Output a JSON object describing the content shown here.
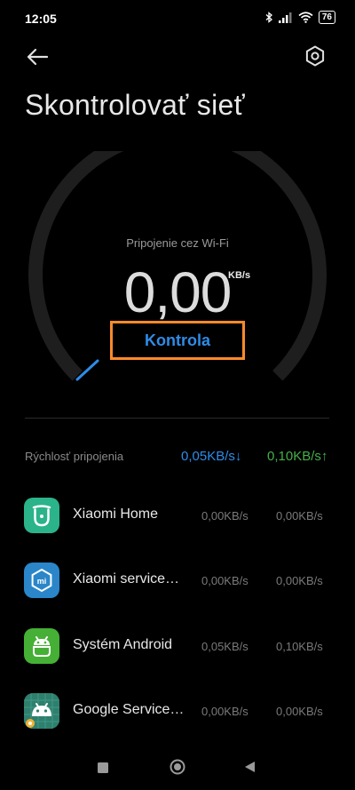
{
  "status": {
    "time": "12:05",
    "battery": "76"
  },
  "page": {
    "title": "Skontrolovať sieť"
  },
  "gauge": {
    "connection_label": "Pripojenie cez Wi-Fi",
    "speed_value": "0,00",
    "speed_unit": "KB/s"
  },
  "check_button": {
    "label": "Kontrola"
  },
  "connection_speed": {
    "label": "Rýchlosť pripojenia",
    "download": "0,05KB/s↓",
    "upload": "0,10KB/s↑"
  },
  "apps": [
    {
      "name": "Xiaomi Home",
      "download": "0,00KB/s",
      "upload": "0,00KB/s",
      "icon": "xiaomi-home-icon"
    },
    {
      "name": "Xiaomi service…",
      "download": "0,00KB/s",
      "upload": "0,00KB/s",
      "icon": "xiaomi-service-icon"
    },
    {
      "name": "Systém Android",
      "download": "0,05KB/s",
      "upload": "0,10KB/s",
      "icon": "android-system-icon"
    },
    {
      "name": "Google Service…",
      "download": "0,00KB/s",
      "upload": "0,00KB/s",
      "icon": "google-services-icon"
    }
  ],
  "colors": {
    "accent_blue": "#2f8ce8",
    "upload_green": "#43b04a",
    "highlight_orange": "#ff8a2a"
  }
}
